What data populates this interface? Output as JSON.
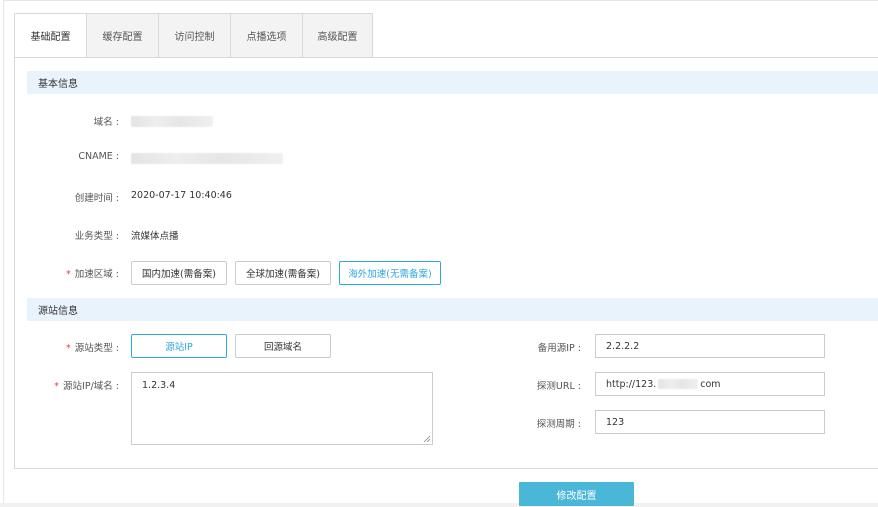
{
  "tabs": [
    {
      "label": "基础配置",
      "active": true
    },
    {
      "label": "缓存配置",
      "active": false
    },
    {
      "label": "访问控制",
      "active": false
    },
    {
      "label": "点播选项",
      "active": false
    },
    {
      "label": "高级配置",
      "active": false
    }
  ],
  "basic_info": {
    "header": "基本信息",
    "domain_label": "域名 :",
    "cname_label": "CNAME :",
    "created_label": "创建时间 :",
    "created_value": "2020-07-17 10:40:46",
    "business_label": "业务类型 :",
    "business_value": "流媒体点播",
    "region_label": "加速区域 :",
    "region_options": [
      "国内加速(需备案)",
      "全球加速(需备案)",
      "海外加速(无需备案)"
    ],
    "region_selected": "海外加速(无需备案)"
  },
  "origin_info": {
    "header": "源站信息",
    "type_label": "源站类型 :",
    "type_options": [
      "源站IP",
      "回源域名"
    ],
    "type_selected": "源站IP",
    "address_label": "源站IP/域名 :",
    "address_value": "1.2.3.4",
    "backup_label": "备用源IP :",
    "backup_value": "2.2.2.2",
    "probe_url_label": "探测URL :",
    "probe_url_prefix": "http://123.",
    "probe_url_suffix": "com",
    "probe_period_label": "探测周期 :",
    "probe_period_value": "123"
  },
  "submit_label": "修改配置",
  "required_mark": "*",
  "colors": {
    "accent": "#2fa7e0",
    "section_bg": "#e9f3fc",
    "submit_bg": "#4ab7d8",
    "required": "#e8413a"
  }
}
